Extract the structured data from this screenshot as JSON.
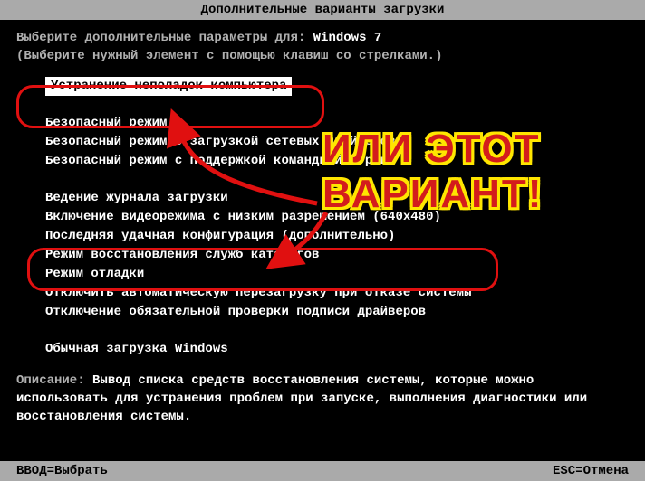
{
  "title": "Дополнительные варианты загрузки",
  "intro_prefix": "Выберите дополнительные параметры для: ",
  "os_name": "Windows 7",
  "intro_hint": "(Выберите нужный элемент с помощью клавиш со стрелками.)",
  "menu": {
    "selected": "Устранение неполадок компьютера",
    "items_group1": [
      "Безопасный режим",
      "Безопасный режим с загрузкой сетевых драйверов",
      "Безопасный режим с поддержкой командной строки"
    ],
    "items_group2": [
      "Ведение журнала загрузки",
      "Включение видеорежима с низким разрешением (640x480)",
      "Последняя удачная конфигурация (дополнительно)",
      "Режим восстановления служб каталогов",
      "Режим отладки",
      "Отключить автоматическую перезагрузку при отказе системы",
      "Отключение обязательной проверки подписи драйверов"
    ],
    "items_group3": [
      "Обычная загрузка Windows"
    ]
  },
  "desc_label": "Описание: ",
  "desc_text": "Вывод списка средств восстановления системы, которые можно использовать для устранения проблем при запуске, выполнения диагностики или восстановления системы.",
  "footer_left": "ВВОД=Выбрать",
  "footer_right": "ESC=Отмена",
  "annotation": "ИЛИ ЭТОТ\nВАРИАНТ!"
}
